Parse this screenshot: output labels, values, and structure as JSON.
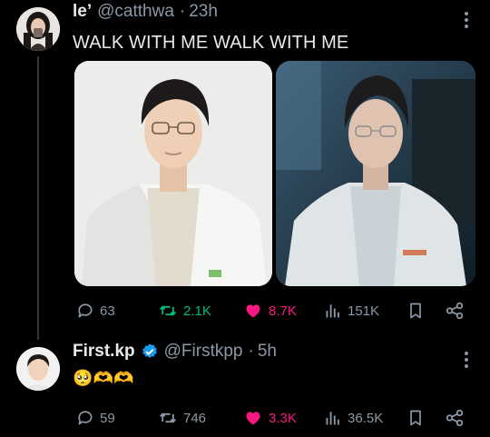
{
  "colors": {
    "background": "#000000",
    "text": "#e7e9ea",
    "secondary": "#8b98a5",
    "retweet": "#00ba7c",
    "like": "#f91880",
    "verified": "#1d9bf0"
  },
  "tweet1": {
    "name": "le’",
    "handle": "@catthwa",
    "separator": "·",
    "time": "23h",
    "text": "WALK WITH ME WALK WITH ME",
    "stats": {
      "replies": "63",
      "retweets": "2.1K",
      "likes": "8.7K",
      "views": "151K"
    },
    "liked": true,
    "retweeted": true
  },
  "tweet2": {
    "name": "First.kp",
    "verified": true,
    "handle": "@Firstkpp",
    "separator": "·",
    "time": "5h",
    "text": "🥺🫶🫶",
    "stats": {
      "replies": "59",
      "retweets": "746",
      "likes": "3.3K",
      "views": "36.5K"
    },
    "liked": true
  },
  "icons": [
    "reply-icon",
    "retweet-icon",
    "like-icon",
    "views-icon",
    "bookmark-icon",
    "share-icon",
    "more-icon",
    "verified-icon"
  ]
}
